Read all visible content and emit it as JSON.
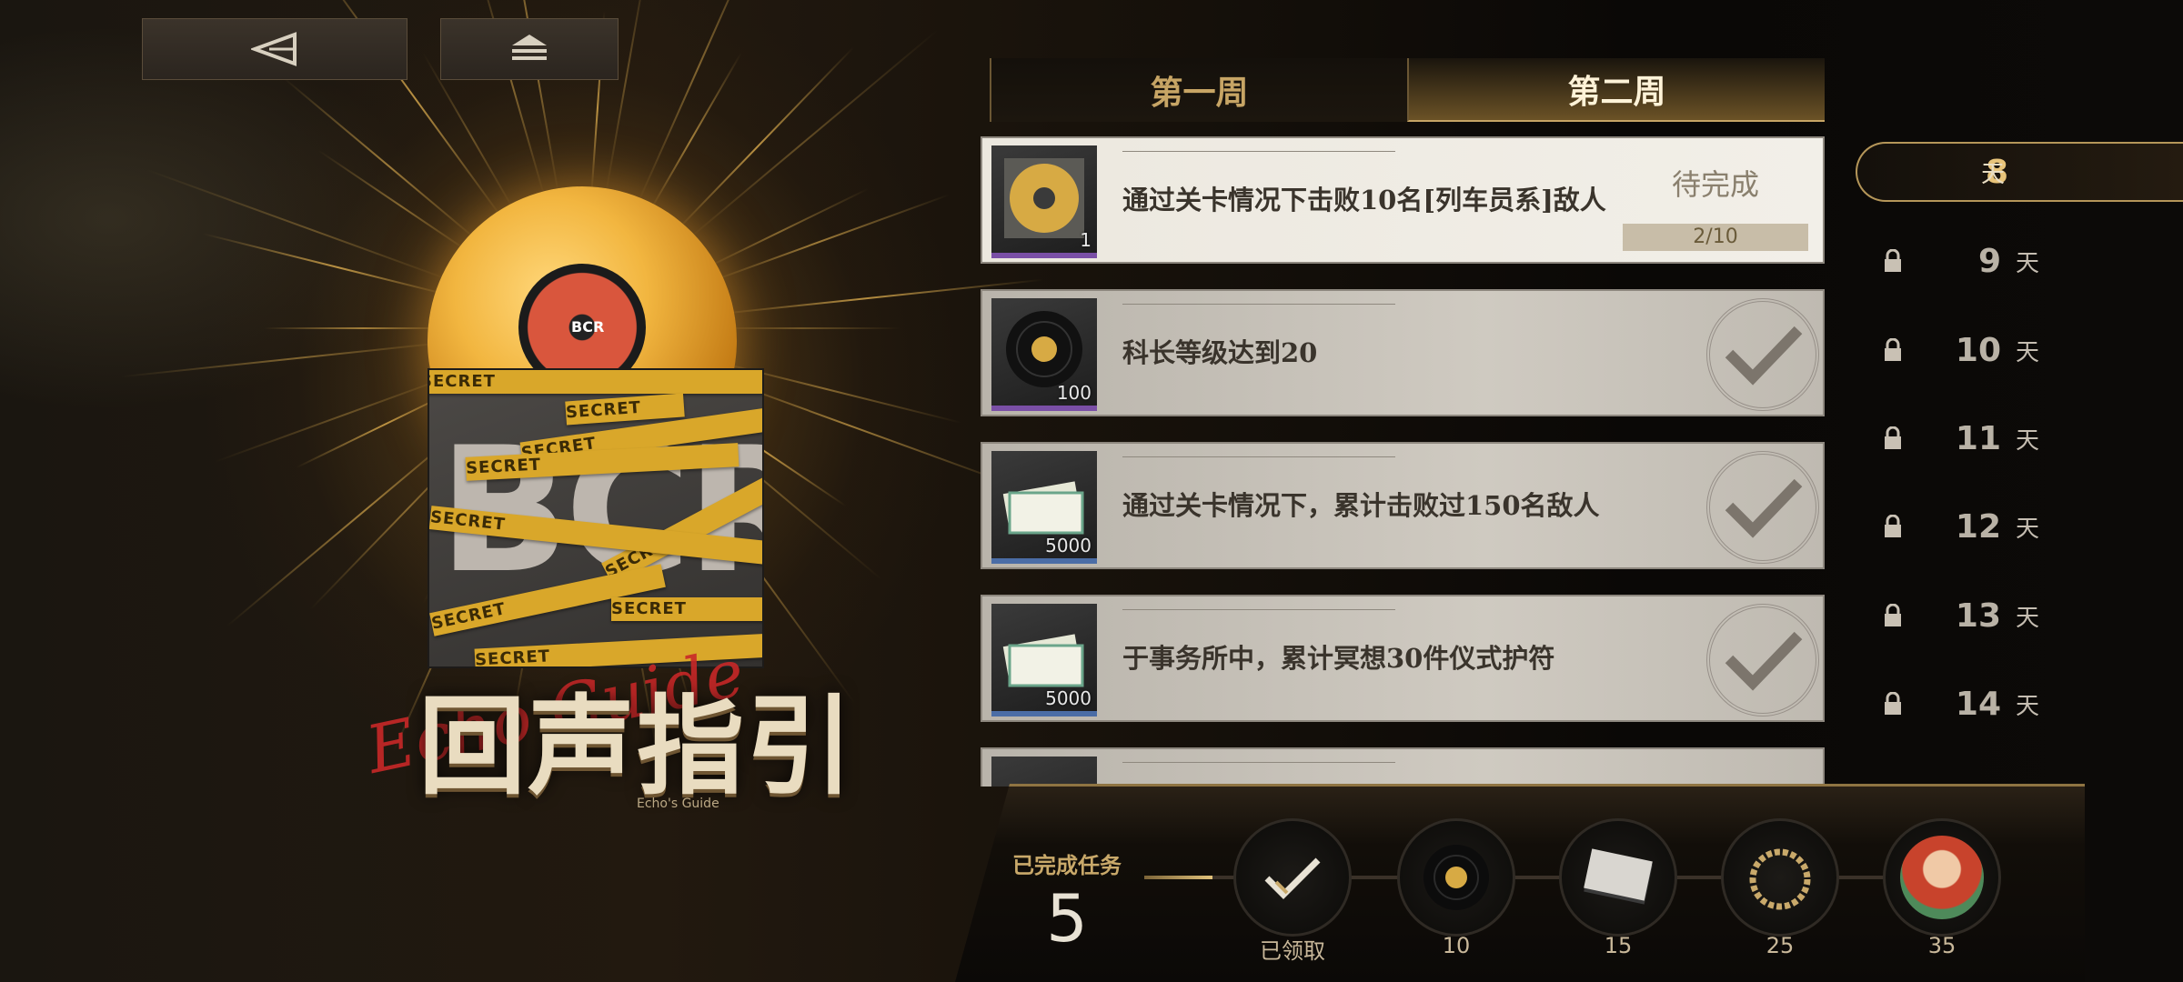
{
  "nav": {
    "back_icon": "back-triangle-icon",
    "home_icon": "home-stack-icon"
  },
  "banner": {
    "title": "回声指引",
    "script_title": "Echo Guide",
    "subtitle": "Echo's Guide",
    "tape_text": "SECRET",
    "sleeve_logo": "BCR",
    "record_label": "BCR"
  },
  "weeks": {
    "tabs": [
      {
        "label": "第一周",
        "active": false
      },
      {
        "label": "第二周",
        "active": true
      }
    ]
  },
  "tasks": [
    {
      "text": "通过关卡情况下击败10名[列车员系]敌人",
      "reward_icon": "gold-record-icon",
      "reward_count": "1",
      "status": "待完成",
      "progress": "2/10",
      "completed": false
    },
    {
      "text": "科长等级达到20",
      "reward_icon": "vinyl-record-icon",
      "reward_count": "100",
      "status": "",
      "completed": true
    },
    {
      "text": "通过关卡情况下，累计击败过150名敌人",
      "reward_icon": "ticket-stack-icon",
      "reward_count": "5000",
      "status": "",
      "completed": true
    },
    {
      "text": "于事务所中，累计冥想30件仪式护符",
      "reward_icon": "ticket-stack-icon",
      "reward_count": "5000",
      "status": "",
      "completed": true
    }
  ],
  "days": [
    {
      "num": "8",
      "unit": "天",
      "locked": false,
      "selected": true
    },
    {
      "num": "9",
      "unit": "天",
      "locked": true
    },
    {
      "num": "10",
      "unit": "天",
      "locked": true
    },
    {
      "num": "11",
      "unit": "天",
      "locked": true
    },
    {
      "num": "12",
      "unit": "天",
      "locked": true
    },
    {
      "num": "13",
      "unit": "天",
      "locked": true
    },
    {
      "num": "14",
      "unit": "天",
      "locked": true
    }
  ],
  "progress": {
    "done_label": "已完成任务",
    "done_count": "5",
    "fill_fraction": 0.08,
    "milestones": [
      {
        "label": "已领取",
        "icon": "claimed-check-icon"
      },
      {
        "label": "10",
        "icon": "vinyl-record-icon"
      },
      {
        "label": "15",
        "icon": "card-pack-icon"
      },
      {
        "label": "25",
        "icon": "ring-frame-icon"
      },
      {
        "label": "35",
        "icon": "character-portrait-icon"
      }
    ]
  },
  "colors": {
    "accent_gold": "#c7a565",
    "active_tab": "#fff3d8",
    "rarity_purple": "#7a4fa6",
    "rarity_blue": "#4b6da6"
  }
}
